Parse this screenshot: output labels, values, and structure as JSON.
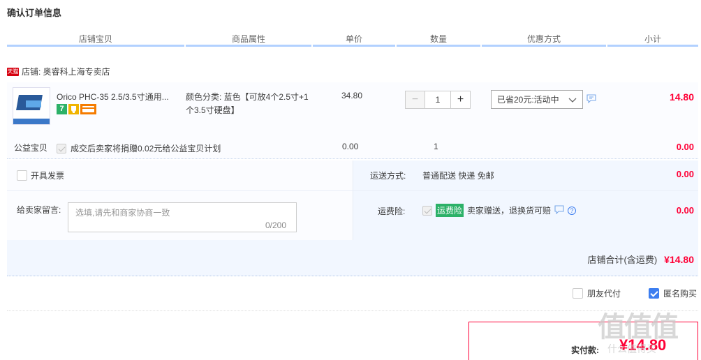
{
  "page": {
    "title": "确认订单信息"
  },
  "columns": [
    "店铺宝贝",
    "商品属性",
    "单价",
    "数量",
    "优惠方式",
    "小计"
  ],
  "shop": {
    "badge": "天猫",
    "label": "店铺: 奥睿科上海专卖店"
  },
  "item": {
    "name": "Orico PHC-35 2.5/3.5寸通用...",
    "attr": "颜色分类: 蓝色【可放4个2.5寸+1个3.5寸硬盘】",
    "price": "34.80",
    "qty": "1",
    "minus": "−",
    "plus": "+",
    "promo": "已省20元:活动中",
    "subtotal": "14.80",
    "badge_7": "7"
  },
  "charity": {
    "label": "公益宝贝",
    "text": "成交后卖家将捐赠0.02元给公益宝贝计划",
    "price": "0.00",
    "qty": "1",
    "subtotal": "0.00"
  },
  "invoice": {
    "label": "开具发票"
  },
  "shipping": {
    "label": "运送方式:",
    "value": "普通配送 快递 免邮",
    "price": "0.00"
  },
  "message": {
    "label": "给卖家留言:",
    "placeholder": "选填,请先和商家协商一致",
    "count": "0/200"
  },
  "insurance": {
    "label": "运费险:",
    "tag": "运费险",
    "text": "卖家赠送，退换货可赔",
    "help": "?",
    "price": "0.00"
  },
  "shop_total": {
    "label": "店铺合计(含运费)",
    "amount": "¥14.80"
  },
  "options": {
    "friend_pay": "朋友代付",
    "anonymous": "匿名购买"
  },
  "payment": {
    "label": "实付款:",
    "amount": "¥14.80"
  },
  "watermark": {
    "main": "值值值",
    "sub": "什么值得买"
  },
  "colors": {
    "accent_red": "#ff0036",
    "header_line": "#b2d1ff",
    "green_tag": "#2cb168",
    "check_blue": "#3d7ef0"
  }
}
